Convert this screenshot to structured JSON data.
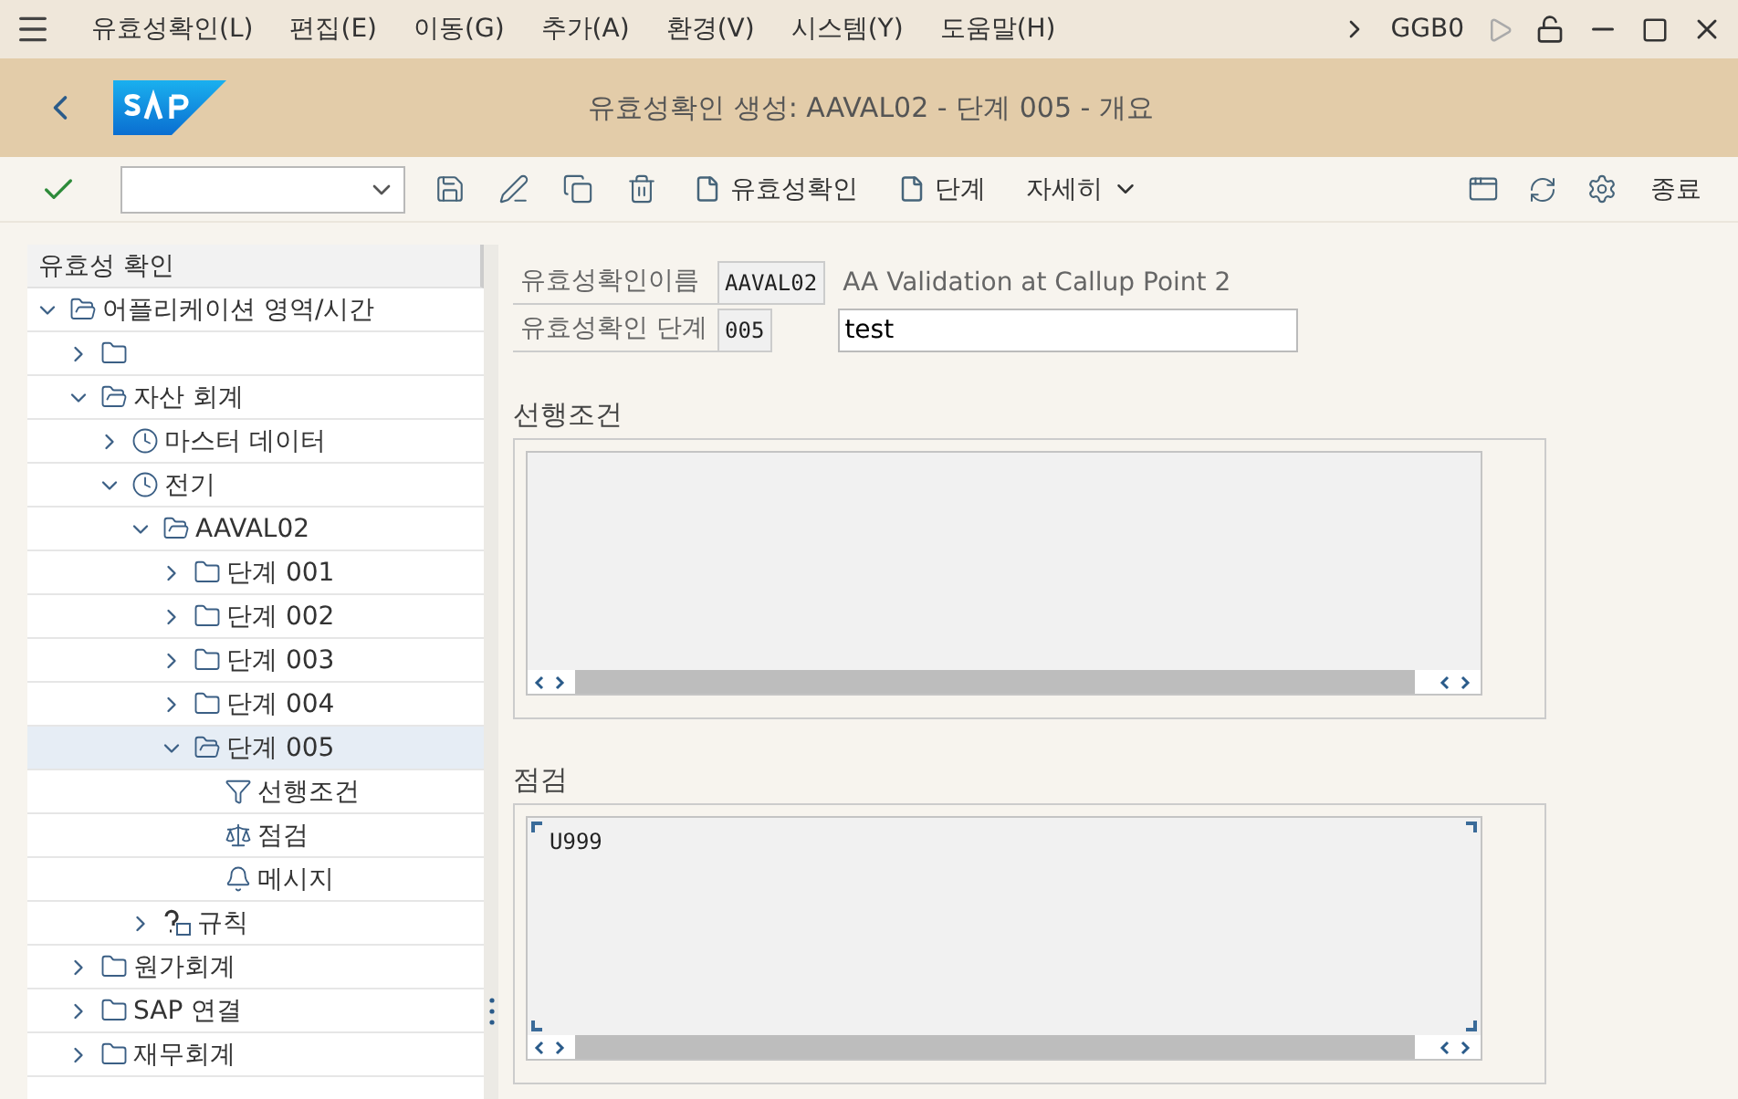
{
  "menu": [
    "유효성확인(L)",
    "편집(E)",
    "이동(G)",
    "추가(A)",
    "환경(V)",
    "시스템(Y)",
    "도움말(H)"
  ],
  "system_id": "GGB0",
  "title": "유효성확인 생성: AAVAL02 - 단계 005 - 개요",
  "toolbar": {
    "buttons": [
      {
        "label": "유효성확인",
        "kind": "doc"
      },
      {
        "label": "단계",
        "kind": "doc"
      },
      {
        "label": "자세히",
        "kind": "more"
      }
    ],
    "exit": "종료"
  },
  "tree": {
    "header": "유효성 확인",
    "nodes": [
      {
        "label": "어플리케이션 영역/시간",
        "kind": "open",
        "expanded": true,
        "selected": false,
        "children": [
          {
            "kind": "folder",
            "expanded": false,
            "selected": false
          },
          {
            "label": "자산 회계",
            "kind": "open",
            "expanded": true,
            "selected": false,
            "children": [
              {
                "label": "마스터 데이터",
                "kind": "clock",
                "expanded": false,
                "selected": false
              },
              {
                "label": "전기",
                "kind": "clock",
                "expanded": true,
                "selected": false,
                "children": [
                  {
                    "label": "AAVAL02",
                    "kind": "open",
                    "expanded": true,
                    "selected": false,
                    "children": [
                      {
                        "label": "단계 001",
                        "kind": "folder",
                        "expanded": false,
                        "selected": false
                      },
                      {
                        "label": "단계 002",
                        "kind": "folder",
                        "expanded": false,
                        "selected": false
                      },
                      {
                        "label": "단계 003",
                        "kind": "folder",
                        "expanded": false,
                        "selected": false
                      },
                      {
                        "label": "단계 004",
                        "kind": "folder",
                        "expanded": false,
                        "selected": false
                      },
                      {
                        "label": "단계 005",
                        "kind": "open",
                        "expanded": true,
                        "selected": true,
                        "children": [
                          {
                            "label": "선행조건",
                            "kind": "filter",
                            "selected": false
                          },
                          {
                            "label": "점검",
                            "kind": "scale",
                            "selected": false
                          },
                          {
                            "label": "메시지",
                            "kind": "bell",
                            "selected": false
                          }
                        ]
                      }
                    ]
                  },
                  {
                    "label": "규칙",
                    "kind": "rule",
                    "expanded": false,
                    "selected": false
                  }
                ]
              }
            ]
          },
          {
            "label": "원가회계",
            "kind": "folder",
            "expanded": false,
            "selected": false
          },
          {
            "label": "SAP 연결",
            "kind": "folder",
            "expanded": false,
            "selected": false
          },
          {
            "label": "재무회계",
            "kind": "folder",
            "expanded": false,
            "selected": false
          }
        ]
      }
    ]
  },
  "fields": [
    {
      "label": "유효성확인이름",
      "value": "AAVAL02",
      "text": "AA Validation at Callup Point 2"
    },
    {
      "label": "유효성확인 단계",
      "value": "005",
      "input": "test"
    }
  ],
  "sections": [
    {
      "title": "선행조건",
      "focused": false
    },
    {
      "title": "점검",
      "lines": [
        "U999"
      ],
      "focused": true
    }
  ]
}
